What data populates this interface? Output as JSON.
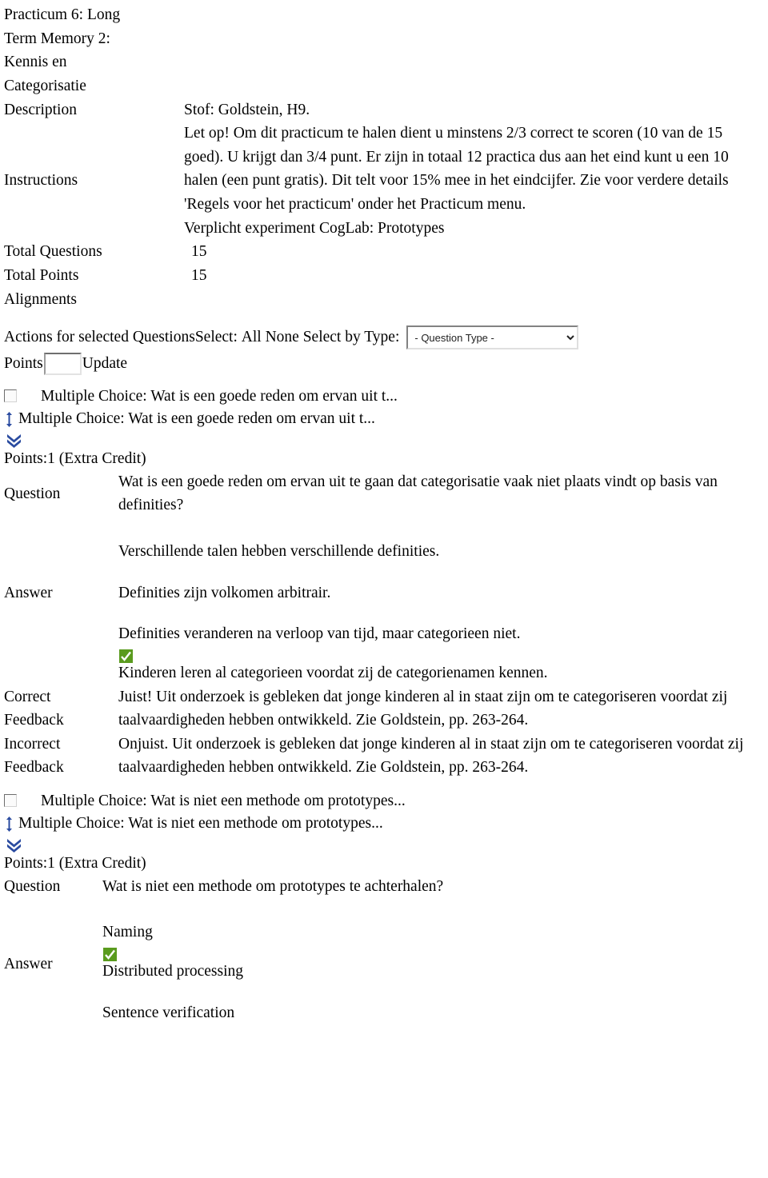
{
  "header": {
    "title_lines": [
      "Practicum 6: Long",
      "Term Memory 2:",
      "Kennis en",
      "Categorisatie"
    ]
  },
  "meta": {
    "description_label": "Description",
    "description_value": "Stof: Goldstein, H9.",
    "instructions_label": "Instructions",
    "instructions_value": "Let op! Om dit practicum te halen dient u minstens 2/3 correct te scoren (10 van de 15 goed). U krijgt dan 3/4 punt. Er zijn in totaal 12 practica dus aan het eind kunt u een 10 halen (een punt gratis). Dit telt voor 15% mee in het eindcijfer. Zie voor verdere details 'Regels voor het practicum' onder het Practicum menu.",
    "instructions_extra": "Verplicht experiment CogLab: Prototypes",
    "total_questions_label": "Total Questions",
    "total_questions_value": "15",
    "total_points_label": "Total Points",
    "total_points_value": "15",
    "alignments_label": "Alignments"
  },
  "actions": {
    "actions_label": "Actions for selected Questions",
    "select_label": "Select:",
    "select_all": "All",
    "select_none": "None",
    "select_by_type_label": "Select by Type:",
    "question_type_selected": "- Question Type -",
    "question_type_options": [
      "- Question Type -"
    ],
    "points_label": "Points",
    "points_value": "",
    "points_placeholder": "",
    "update_label": "Update"
  },
  "questions": [
    {
      "checkbox_title": "Multiple Choice: Wat is een goede reden om ervan uit t...",
      "reorder_title": "Multiple Choice: Wat is een goede reden om ervan uit t...",
      "points_line": "Points:1 (Extra Credit)",
      "question_label": "Question",
      "question_text": "Wat is een goede reden om ervan uit te gaan dat categorisatie vaak niet plaats vindt op basis van definities?",
      "answer_label": "Answer",
      "answers": [
        {
          "text": "Verschillende talen hebben verschillende definities.",
          "correct": false
        },
        {
          "text": "Definities zijn volkomen arbitrair.",
          "correct": false
        },
        {
          "text": "Definities veranderen na verloop van tijd, maar categorieen niet.",
          "correct": false
        },
        {
          "text": "Kinderen leren al categorieen voordat zij de categorienamen kennen.",
          "correct": true
        }
      ],
      "correct_feedback_label": "Correct Feedback",
      "correct_feedback_text": "Juist! Uit onderzoek is gebleken dat jonge kinderen al in staat zijn om te categoriseren voordat zij taalvaardigheden hebben ontwikkeld. Zie Goldstein, pp. 263-264.",
      "incorrect_feedback_label": "Incorrect Feedback",
      "incorrect_feedback_text": "Onjuist. Uit onderzoek is gebleken dat jonge kinderen al in staat zijn om te categoriseren voordat zij taalvaardigheden hebben ontwikkeld. Zie Goldstein, pp. 263-264."
    },
    {
      "checkbox_title": "Multiple Choice: Wat is niet een methode om prototypes...",
      "reorder_title": "Multiple Choice: Wat is niet een methode om prototypes...",
      "points_line": "Points:1 (Extra Credit)",
      "question_label": "Question",
      "question_text": "Wat is niet een methode om prototypes te achterhalen?",
      "answer_label": "Answer",
      "answers": [
        {
          "text": "Naming",
          "correct": false
        },
        {
          "text": "Distributed processing",
          "correct": true
        },
        {
          "text": "Sentence verification",
          "correct": false
        }
      ]
    }
  ],
  "icons": {
    "checkbox": "checkbox-icon",
    "reorder": "up-down-arrow-icon",
    "move_down": "double-chevron-down-icon",
    "correct": "green-check-icon",
    "dropdown_arrow": "chevron-down-icon"
  },
  "colors": {
    "icon_blue": "#2a4ba0",
    "check_green": "#5a9b1e",
    "text": "#000000",
    "background": "#ffffff"
  }
}
